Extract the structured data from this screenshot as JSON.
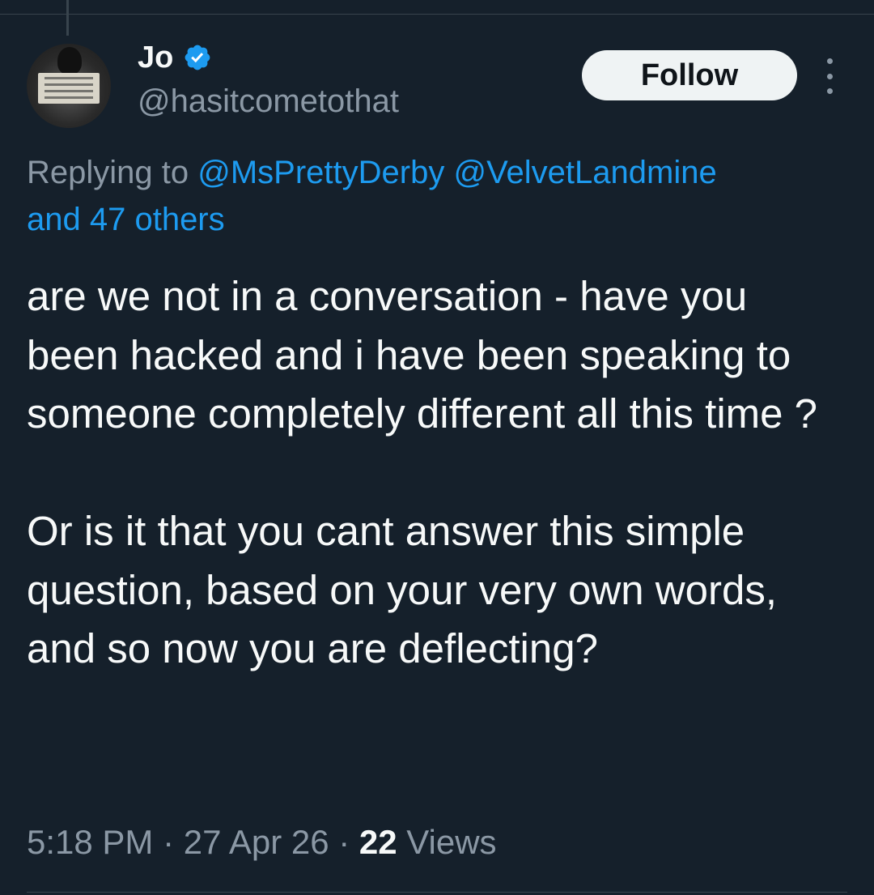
{
  "author": {
    "display_name": "Jo",
    "handle": "@hasitcometothat",
    "verified": true,
    "avatar_alt": "profile photo"
  },
  "actions": {
    "follow_label": "Follow",
    "more_icon": "more-vertical-icon"
  },
  "reply_context": {
    "prefix": "Replying to ",
    "mentions": [
      "@MsPrettyDerby",
      "@VelvetLandmine"
    ],
    "others": "and 47 others"
  },
  "tweet": {
    "paragraphs": [
      "are we not in a conversation -  have you been hacked and i have been speaking to someone completely different all this time ?",
      "Or is it that you cant answer this simple question, based on your very own words, and so now you are deflecting?"
    ]
  },
  "meta": {
    "time": "5:18 PM",
    "separator": " · ",
    "date": "27 Apr 26",
    "views_count": "22",
    "views_label": " Views"
  },
  "colors": {
    "background": "#15202b",
    "text": "#f7f9f9",
    "muted": "#8b98a5",
    "link": "#1d9bf0",
    "follow_bg": "#eff3f4",
    "divider": "#38444d"
  }
}
